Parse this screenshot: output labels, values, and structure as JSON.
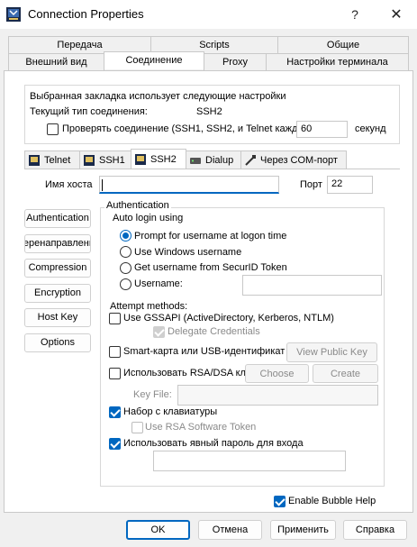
{
  "window": {
    "title": "Connection Properties",
    "help_glyph": "?",
    "close_glyph": "✕"
  },
  "tabs_row1": [
    "Передача",
    "Scripts",
    "Общие"
  ],
  "tabs_row2": [
    "Внешний вид",
    "Соединение",
    "Proxy",
    "Настройки терминала"
  ],
  "info": {
    "line1": "Выбранная закладка использует следующие настройки",
    "conn_type_label": "Текущий тип соединения:",
    "conn_type_value": "SSH2",
    "check_label": "Проверять соединение (SSH1, SSH2, и Telnet кажд",
    "check_value": "60",
    "seconds": "секунд"
  },
  "subtabs": [
    "Telnet",
    "SSH1",
    "SSH2",
    "Dialup",
    "Через COM-порт"
  ],
  "host": {
    "label": "Имя хоста",
    "value": "",
    "port_label": "Порт",
    "port_value": "22"
  },
  "side_buttons": [
    "Authentication",
    "Перенаправления",
    "Compression",
    "Encryption",
    "Host Key",
    "Options"
  ],
  "auth": {
    "group_title": "Authentication",
    "auto_login": "Auto login using",
    "radios": [
      "Prompt for username at logon time",
      "Use Windows username",
      "Get username from SecurID Token",
      "Username:"
    ],
    "username_value": "",
    "attempt_methods": "Attempt methods:",
    "gssapi": "Use GSSAPI (ActiveDirectory, Kerberos, NTLM)",
    "delegate": "Delegate Credentials",
    "smartcard": "Smart-карта или USB-идентификат",
    "view_public_key": "View Public Key",
    "rsa_dsa": "Использовать RSA/DSA кл",
    "choose": "Choose",
    "create": "Create",
    "key_file_label": "Key File:",
    "key_file_value": "",
    "keyboard": "Набор с клавиатуры",
    "rsa_token": "Use RSA Software Token",
    "explicit_password": "Использовать явный пароль для входа",
    "password_value": ""
  },
  "bubble_help": "Enable Bubble Help",
  "footer": {
    "ok": "OK",
    "cancel": "Отмена",
    "apply": "Применить",
    "help": "Справка"
  },
  "colors": {
    "accent": "#0067c0",
    "panel": "#ffffff",
    "chrome": "#f0f0f0"
  }
}
